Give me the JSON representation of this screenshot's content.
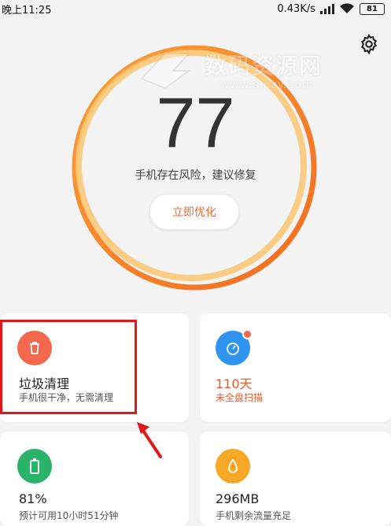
{
  "status_bar": {
    "time": "晚上11:25",
    "net_speed": "0.43K/s",
    "battery": "81"
  },
  "watermark": {
    "brand": "数码资源网",
    "url": "www.smzy.com"
  },
  "score": {
    "value": "77",
    "status_text": "手机存在风险，建议修复",
    "action_label": "立即优化"
  },
  "cards": [
    {
      "title": "垃圾清理",
      "subtitle": "手机很干净，无需清理",
      "icon": "trash-icon",
      "color": "#f4694e"
    },
    {
      "title": "110天",
      "subtitle": "未全盘扫描",
      "icon": "stopwatch-icon",
      "color": "#2f93f0",
      "accent": "#e85a2b"
    },
    {
      "title": "81%",
      "subtitle": "预计可用10小时51分钟",
      "icon": "battery-icon",
      "color": "#2cb36a"
    },
    {
      "title": "296MB",
      "subtitle": "手机剩余流量充足",
      "icon": "drop-icon",
      "color": "#f7a826"
    }
  ],
  "colors": {
    "ring_outer": "#f7831f",
    "ring_inner": "#fbc46a",
    "highlight": "#e0181a"
  }
}
